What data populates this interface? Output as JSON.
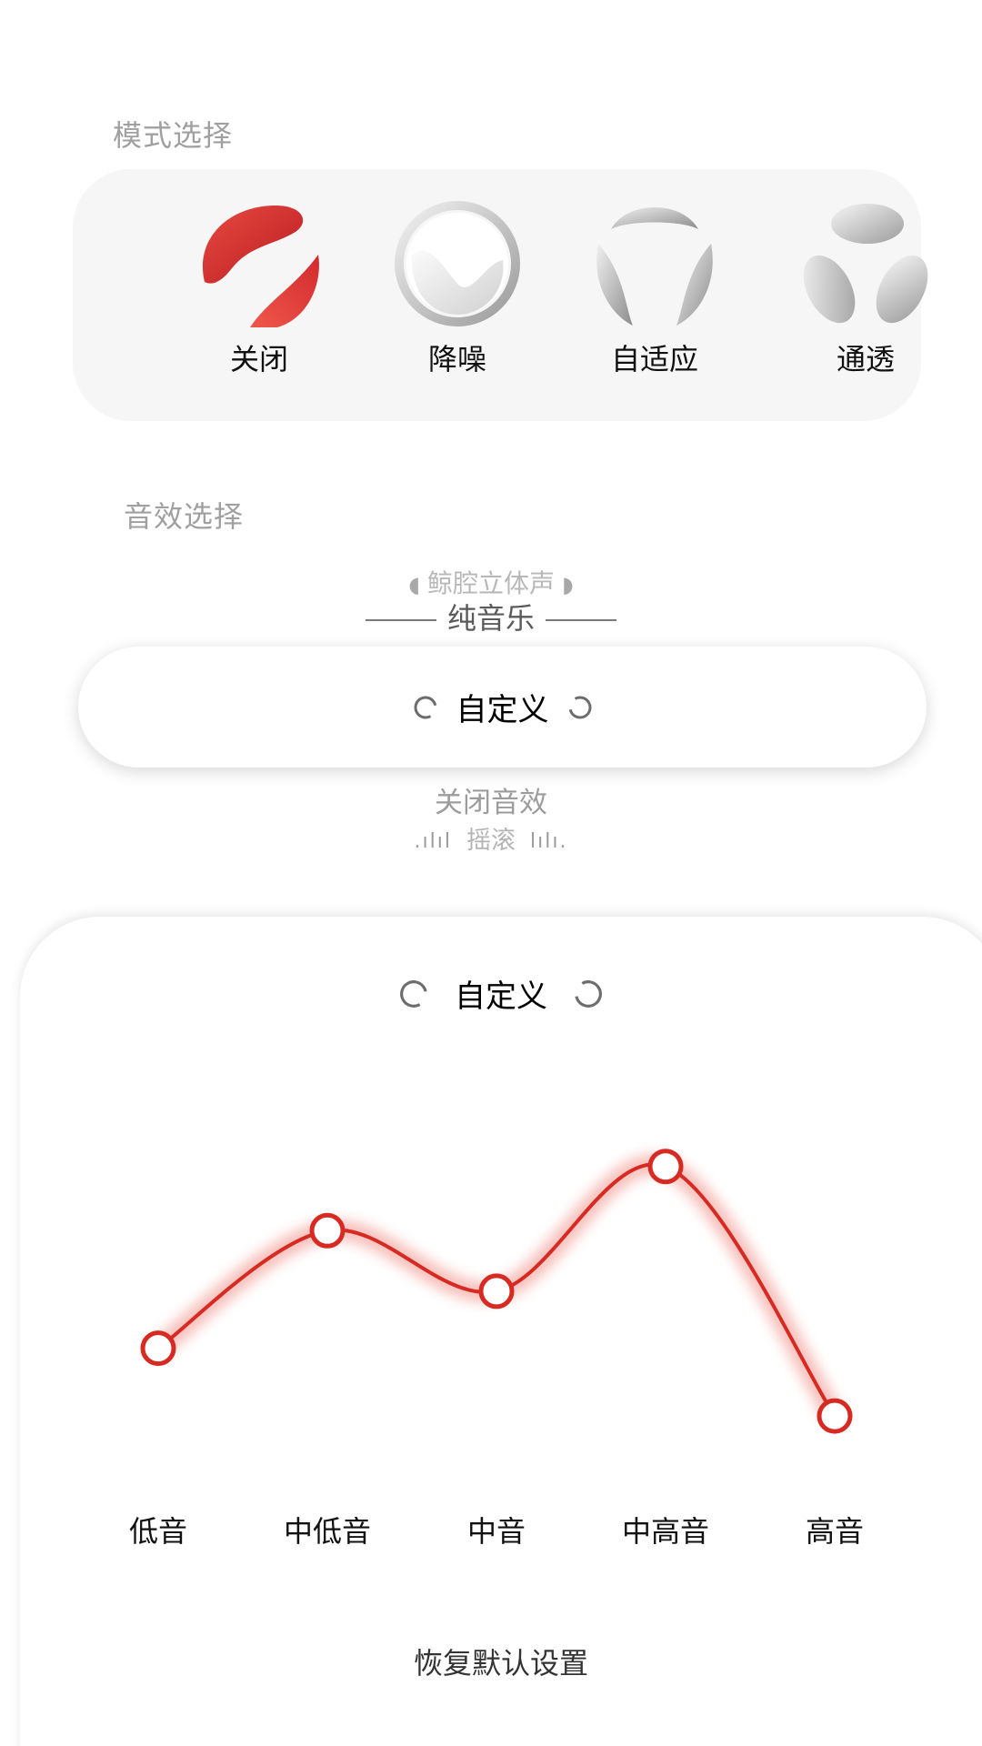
{
  "mode_section": {
    "title": "模式选择",
    "modes": [
      {
        "label": "关闭",
        "icon": "red-petals-icon",
        "selected": true
      },
      {
        "label": "降噪",
        "icon": "noise-cancel-ring-icon",
        "selected": false
      },
      {
        "label": "自适应",
        "icon": "adaptive-triad-icon",
        "selected": false
      },
      {
        "label": "通透",
        "icon": "transparent-triad-icon",
        "selected": false
      }
    ]
  },
  "effect_section": {
    "title": "音效选择",
    "options": {
      "whale": "鲸腔立体声",
      "pure": "纯音乐",
      "selected": "自定义",
      "close": "关闭音效",
      "rock": "摇滚"
    }
  },
  "eq_panel": {
    "title": "自定义",
    "reset_label": "恢复默认设置",
    "accent_color": "#d62a22",
    "bands": [
      {
        "label": "低音",
        "level": 0.33
      },
      {
        "label": "中低音",
        "level": 0.66
      },
      {
        "label": "中音",
        "level": 0.49
      },
      {
        "label": "中高音",
        "level": 0.84
      },
      {
        "label": "高音",
        "level": 0.14
      }
    ]
  }
}
